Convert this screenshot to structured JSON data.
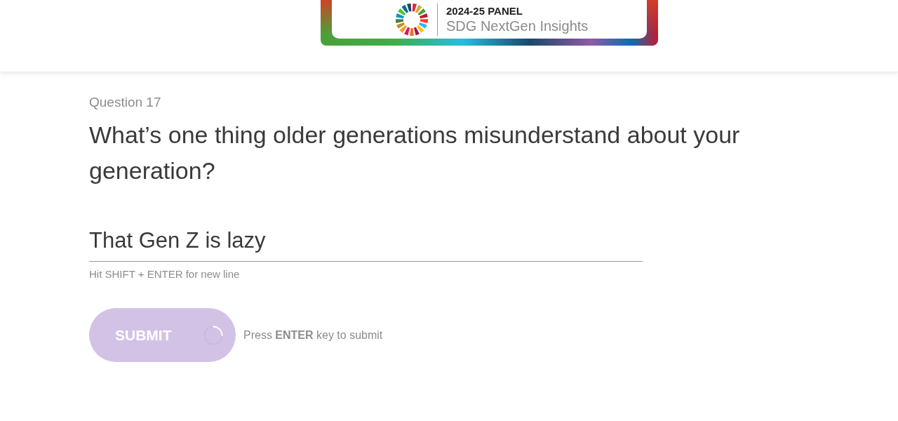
{
  "header": {
    "banner": {
      "title": "2024-25 PANEL",
      "subtitle": "SDG NextGen Insights"
    }
  },
  "question": {
    "number": "Question 17",
    "text": "What’s one thing older generations misunderstand about your generation?"
  },
  "answer": {
    "value": "That Gen Z is lazy",
    "hint": "Hit SHIFT + ENTER for new line"
  },
  "submit": {
    "label": "SUBMIT",
    "loading": true,
    "disabled": true,
    "hint": "Press **ENTER** key to submit"
  }
}
